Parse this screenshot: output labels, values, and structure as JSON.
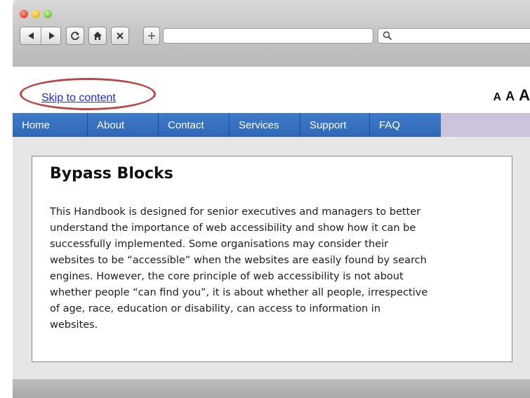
{
  "window": {
    "traffic_light_colors": [
      "#e0433a",
      "#e9b620",
      "#6cc63d"
    ]
  },
  "toolbar": {
    "icons": [
      "back-icon",
      "forward-icon",
      "reload-icon",
      "home-icon",
      "close-icon",
      "new-tab-icon"
    ],
    "url_value": "",
    "search_value": "",
    "search_icon": "search-icon"
  },
  "page": {
    "skip_link": "Skip to content",
    "font_size_controls": [
      "A",
      "A",
      "A"
    ],
    "highlight_color": "#b8464a",
    "nav": {
      "items": [
        {
          "label": "Home"
        },
        {
          "label": "About"
        },
        {
          "label": "Contact"
        },
        {
          "label": "Services"
        },
        {
          "label": "Support"
        },
        {
          "label": "FAQ"
        }
      ],
      "color": "#3a72c1"
    },
    "content": {
      "heading": "Bypass Blocks",
      "lines": [
        "This Handbook is designed for senior executives and managers to better",
        "understand the importance of web accessibility and show how it can be",
        "successfully implemented. Some organisations may consider their",
        "websites to be “accessible” when the websites are easily found by search",
        "engines. However, the core principle of web accessibility is not about",
        "whether people “can find you”, it is about whether all people, irrespective",
        "of age, race, education or disability, can access to information in",
        "websites."
      ]
    }
  }
}
